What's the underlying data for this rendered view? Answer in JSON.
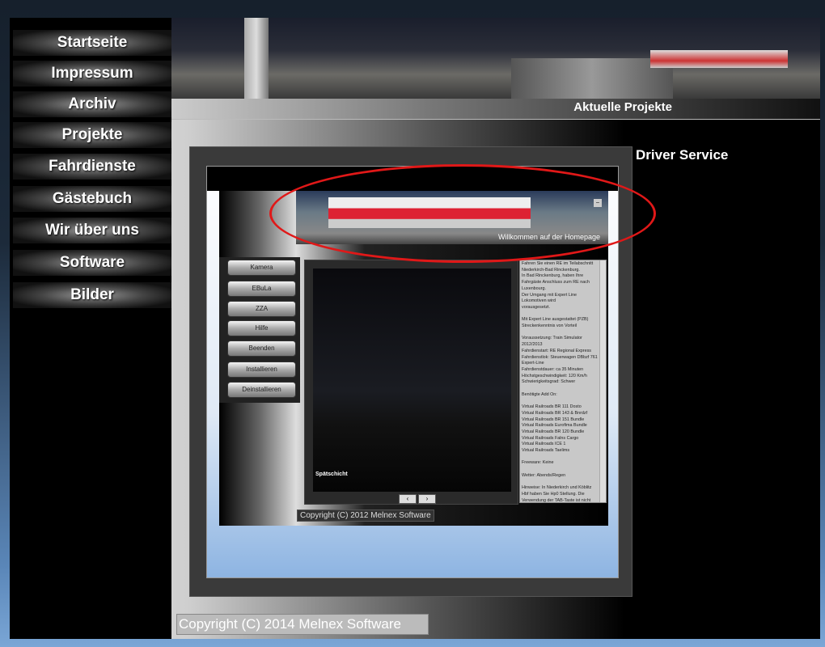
{
  "nav": [
    "Startseite",
    "Impressum",
    "Archiv",
    "Projekte",
    "Fahrdienste",
    "Gästebuch",
    "Wir über uns",
    "Software",
    "Bilder"
  ],
  "section_title": "Aktuelle Projekte",
  "project_title": "Driver Service",
  "app": {
    "welcome": "Willkommen auf der Homepage",
    "buttons": [
      "Kamera",
      "EBuLa",
      "ZZA",
      "Hilfe",
      "Beenden",
      "Installieren",
      "Deinstallieren"
    ],
    "screen_label": "Spätschicht",
    "prev": "‹",
    "next": "›",
    "text": [
      "Fahren Sie einen RE im Teilabschnitt Niederkirch-Bad Rinckenburg.\nIn Bad Rinckenburg, haben Ihre Fahrgäste Anschluss zum RE nach Luxenbourg.\nDer Umgang mit Expert Line Lokomotiven wird\nvorausgesetzt.",
      "Mit Expert Line ausgestattet (PZB)\nStreckenkenntnis von Vorteil",
      "Voraussetzung: Train Simulator 2012/2013\nFahrdienstart:  RE Regional Express\nFahrdienstlok: Steuerwagen DBbzf 761 Expert-Line\nFahrdienstdauer: ca 35 Minuten\nHöchstgeschwindigkeit: 120 Km/h\nSchwierigkeitsgrad: Schwer",
      "Benötigte Add On:",
      "    Virtual Railroads BR 111 Dosto\n    Virtual Railroads BR 143 & Bnrdzf\n    Virtual Railroads BR 151 Bundle\n    Virtual Railroads Eurofima Bundle\n    Virtual Railroads BR 120 Bundle\n    Virtual Railroads Falns Cargo\n    Virtual Railroads ICE 1\n    Virtual Railroads Taelims",
      "Freeware: Keine",
      "Wetter: Abends/Regen",
      "Hinweise: In Niederkirch und Köblitz Hbf haben Sie Hp0 Stellung. Die Verwendung der TAB-Taste ist nicht erforderlich."
    ],
    "copyright": "Copyright (C) 2012 Melnex Software"
  },
  "copyright": "Copyright (C) 2014 Melnex Software"
}
